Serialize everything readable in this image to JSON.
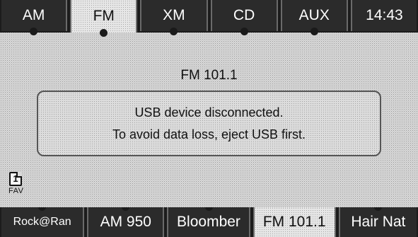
{
  "top_tabs": [
    {
      "label": "AM"
    },
    {
      "label": "FM",
      "active": true
    },
    {
      "label": "XM"
    },
    {
      "label": "CD"
    },
    {
      "label": "AUX"
    },
    {
      "label": "14:43"
    }
  ],
  "main": {
    "station": "FM 101.1",
    "alert_line1": "USB device disconnected.",
    "alert_line2": "To avoid data loss, eject USB first."
  },
  "fav": {
    "page_number": "1",
    "label": "FAV"
  },
  "presets": [
    {
      "label": "Rock@Ran"
    },
    {
      "label": "AM 950"
    },
    {
      "label": "Bloomber"
    },
    {
      "label": "FM 101.1",
      "active": true
    },
    {
      "label": "Hair Nat"
    }
  ]
}
